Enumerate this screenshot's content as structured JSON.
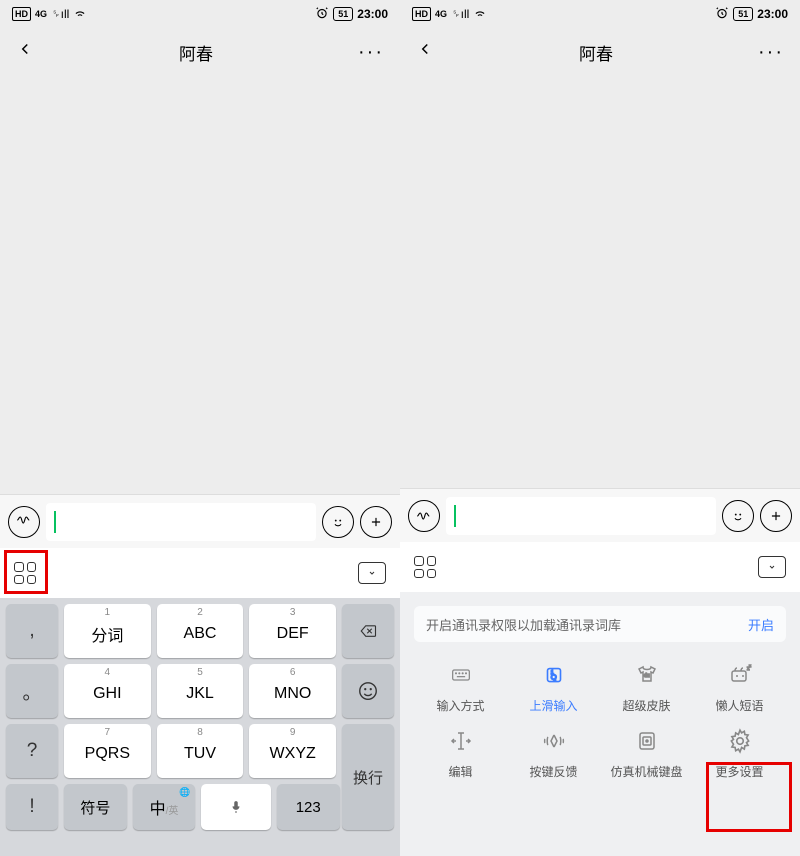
{
  "status": {
    "hd": "HD",
    "fourg": "4G",
    "battery": "51",
    "time": "23:00"
  },
  "header": {
    "title": "阿春"
  },
  "keyboard": {
    "side_left": [
      ",",
      "。",
      "?",
      "!"
    ],
    "keys": [
      {
        "num": "1",
        "main": "分词"
      },
      {
        "num": "2",
        "main": "ABC"
      },
      {
        "num": "3",
        "main": "DEF"
      },
      {
        "num": "4",
        "main": "GHI"
      },
      {
        "num": "5",
        "main": "JKL"
      },
      {
        "num": "6",
        "main": "MNO"
      },
      {
        "num": "7",
        "main": "PQRS"
      },
      {
        "num": "8",
        "main": "TUV"
      },
      {
        "num": "9",
        "main": "WXYZ"
      }
    ],
    "newline": "换行",
    "bottom": {
      "symbols": "符号",
      "lang_main": "中",
      "lang_sub": "/英",
      "numbers": "123"
    }
  },
  "panel": {
    "notice": {
      "text": "开启通讯录权限以加载通讯录词库",
      "action": "开启"
    },
    "items": [
      {
        "label": "输入方式",
        "icon": "keyboard"
      },
      {
        "label": "上滑输入",
        "icon": "swipe",
        "active": true
      },
      {
        "label": "超级皮肤",
        "icon": "skin"
      },
      {
        "label": "懒人短语",
        "icon": "lazy"
      },
      {
        "label": "编辑",
        "icon": "edit"
      },
      {
        "label": "按键反馈",
        "icon": "feedback"
      },
      {
        "label": "仿真机械键盘",
        "icon": "mech"
      },
      {
        "label": "更多设置",
        "icon": "settings"
      }
    ]
  }
}
